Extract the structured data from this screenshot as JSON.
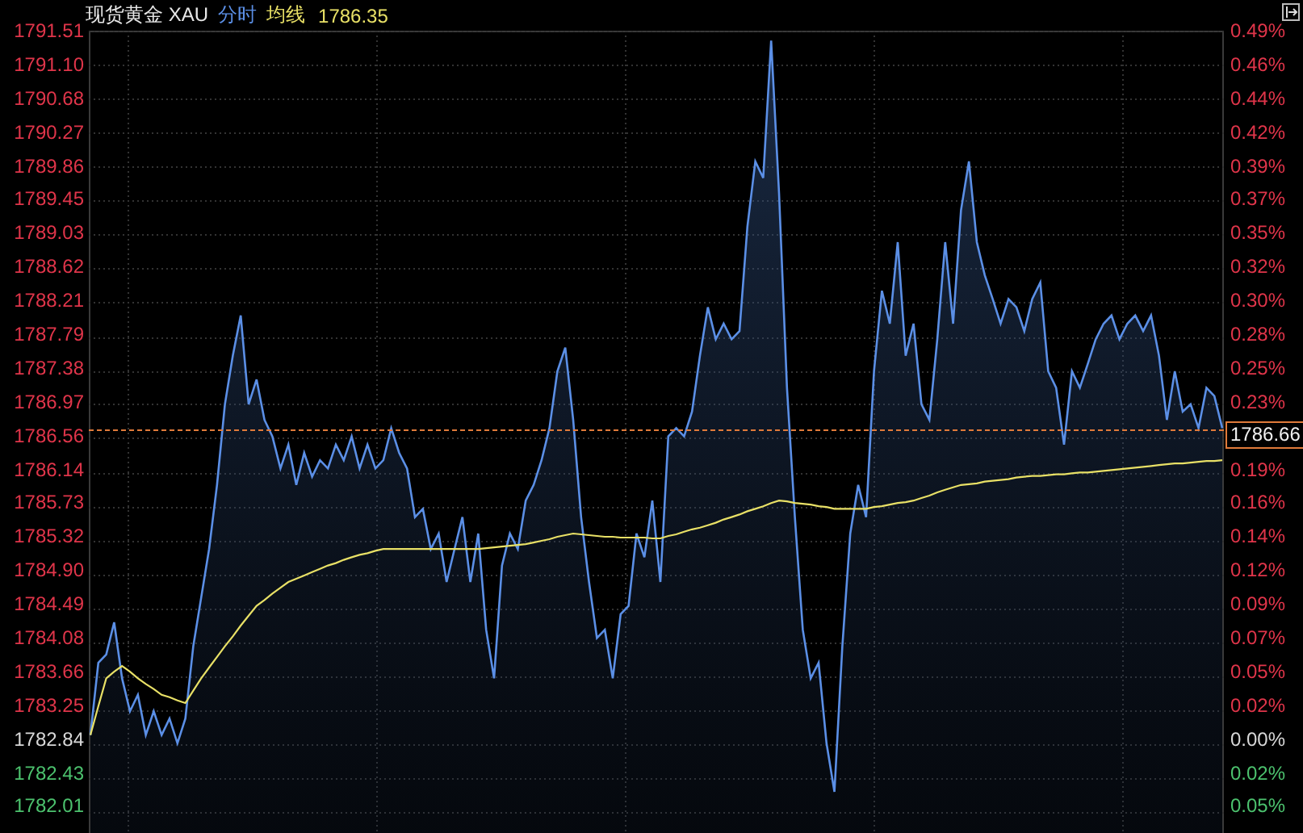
{
  "header": {
    "instrument": "现货黄金 XAU",
    "average_value": "1786.35"
  },
  "price_axis": [
    {
      "kind": "up"
    },
    {
      "kind": "up"
    },
    {
      "kind": "up"
    },
    {
      "kind": "up"
    },
    {
      "kind": "up"
    },
    {
      "kind": "up"
    },
    {
      "kind": "up"
    },
    {
      "kind": "up"
    },
    {
      "kind": "up"
    },
    {
      "kind": "up"
    },
    {
      "kind": "up"
    },
    {
      "kind": "up"
    },
    {
      "kind": "up"
    },
    {
      "kind": "up"
    },
    {
      "kind": "up"
    },
    {
      "kind": "up"
    },
    {
      "kind": "up"
    },
    {
      "kind": "up"
    },
    {
      "kind": "up"
    },
    {
      "kind": "up"
    },
    {
      "kind": "up"
    },
    {
      "kind": "flat"
    },
    {
      "kind": "down"
    },
    {
      "kind": "down"
    }
  ],
  "chart_data": {
    "type": "line",
    "ylim": [
      1781.76,
      1791.51
    ],
    "yticks": [
      {
        "value": 1791.51,
        "label": "1791.51"
      },
      {
        "value": 1791.1,
        "label": "1791.10"
      },
      {
        "value": 1790.68,
        "label": "1790.68"
      },
      {
        "value": 1790.27,
        "label": "1790.27"
      },
      {
        "value": 1789.86,
        "label": "1789.86"
      },
      {
        "value": 1789.45,
        "label": "1789.45"
      },
      {
        "value": 1789.03,
        "label": "1789.03"
      },
      {
        "value": 1788.62,
        "label": "1788.62"
      },
      {
        "value": 1788.21,
        "label": "1788.21"
      },
      {
        "value": 1787.79,
        "label": "1787.79"
      },
      {
        "value": 1787.38,
        "label": "1787.38"
      },
      {
        "value": 1786.97,
        "label": "1786.97"
      },
      {
        "value": 1786.56,
        "label": "1786.56"
      },
      {
        "value": 1786.14,
        "label": "1786.14"
      },
      {
        "value": 1785.73,
        "label": "1785.73"
      },
      {
        "value": 1785.32,
        "label": "1785.32"
      },
      {
        "value": 1784.9,
        "label": "1784.90"
      },
      {
        "value": 1784.49,
        "label": "1784.49"
      },
      {
        "value": 1784.08,
        "label": "1784.08"
      },
      {
        "value": 1783.66,
        "label": "1783.66"
      },
      {
        "value": 1783.25,
        "label": "1783.25"
      },
      {
        "value": 1782.84,
        "label": "1782.84"
      },
      {
        "value": 1782.43,
        "label": "1782.43"
      },
      {
        "value": 1782.01,
        "label": "1782.01"
      }
    ],
    "grid": true,
    "ref_lines": [
      {
        "axis": "y",
        "value": 1786.66,
        "label": "1786.66",
        "color": "#e07a3a"
      }
    ],
    "series": [
      {
        "name": "分时",
        "type": "area",
        "color": "#5b8fe6",
        "values": [
          1782.95,
          1783.83,
          1783.93,
          1784.32,
          1783.64,
          1783.24,
          1783.44,
          1782.95,
          1783.24,
          1782.95,
          1783.15,
          1782.85,
          1783.15,
          1784.03,
          1784.62,
          1785.21,
          1785.99,
          1786.97,
          1787.56,
          1788.05,
          1786.97,
          1787.27,
          1786.78,
          1786.58,
          1786.19,
          1786.48,
          1785.99,
          1786.38,
          1786.09,
          1786.29,
          1786.19,
          1786.48,
          1786.29,
          1786.58,
          1786.19,
          1786.48,
          1786.19,
          1786.29,
          1786.68,
          1786.38,
          1786.19,
          1785.6,
          1785.7,
          1785.21,
          1785.4,
          1784.81,
          1785.21,
          1785.6,
          1784.81,
          1785.4,
          1784.23,
          1783.64,
          1785.01,
          1785.4,
          1785.21,
          1785.8,
          1785.99,
          1786.29,
          1786.68,
          1787.37,
          1787.66,
          1786.78,
          1785.6,
          1784.81,
          1784.13,
          1784.23,
          1783.64,
          1784.42,
          1784.52,
          1785.4,
          1785.11,
          1785.8,
          1784.81,
          1786.58,
          1786.68,
          1786.58,
          1786.88,
          1787.56,
          1788.15,
          1787.76,
          1787.95,
          1787.76,
          1787.86,
          1789.13,
          1789.92,
          1789.72,
          1791.39,
          1789.53,
          1787.17,
          1785.6,
          1784.23,
          1783.64,
          1783.83,
          1782.85,
          1782.26,
          1784.03,
          1785.4,
          1785.99,
          1785.6,
          1787.37,
          1788.35,
          1787.95,
          1788.94,
          1787.56,
          1787.95,
          1786.97,
          1786.78,
          1787.76,
          1788.94,
          1787.95,
          1789.33,
          1789.92,
          1788.94,
          1788.54,
          1788.25,
          1787.95,
          1788.25,
          1788.15,
          1787.86,
          1788.25,
          1788.45,
          1787.37,
          1787.17,
          1786.48,
          1787.37,
          1787.17,
          1787.46,
          1787.76,
          1787.95,
          1788.05,
          1787.76,
          1787.95,
          1788.05,
          1787.86,
          1788.05,
          1787.56,
          1786.78,
          1787.37,
          1786.88,
          1786.97,
          1786.68,
          1787.17,
          1787.07,
          1786.68
        ]
      },
      {
        "name": "均线",
        "color": "#e8e066",
        "values": [
          1782.95,
          1783.3,
          1783.64,
          1783.72,
          1783.79,
          1783.72,
          1783.64,
          1783.57,
          1783.51,
          1783.44,
          1783.41,
          1783.37,
          1783.34,
          1783.49,
          1783.64,
          1783.77,
          1783.9,
          1784.03,
          1784.15,
          1784.28,
          1784.4,
          1784.52,
          1784.59,
          1784.67,
          1784.74,
          1784.81,
          1784.85,
          1784.89,
          1784.93,
          1784.97,
          1785.01,
          1785.04,
          1785.08,
          1785.11,
          1785.14,
          1785.16,
          1785.19,
          1785.21,
          1785.21,
          1785.21,
          1785.21,
          1785.21,
          1785.21,
          1785.21,
          1785.21,
          1785.21,
          1785.21,
          1785.21,
          1785.21,
          1785.21,
          1785.22,
          1785.23,
          1785.24,
          1785.25,
          1785.26,
          1785.27,
          1785.29,
          1785.31,
          1785.33,
          1785.36,
          1785.38,
          1785.4,
          1785.39,
          1785.38,
          1785.37,
          1785.36,
          1785.36,
          1785.35,
          1785.35,
          1785.35,
          1785.35,
          1785.34,
          1785.34,
          1785.37,
          1785.39,
          1785.42,
          1785.45,
          1785.47,
          1785.5,
          1785.53,
          1785.57,
          1785.6,
          1785.63,
          1785.67,
          1785.7,
          1785.73,
          1785.77,
          1785.8,
          1785.79,
          1785.77,
          1785.76,
          1785.75,
          1785.73,
          1785.72,
          1785.7,
          1785.7,
          1785.7,
          1785.7,
          1785.7,
          1785.72,
          1785.73,
          1785.75,
          1785.77,
          1785.78,
          1785.8,
          1785.83,
          1785.86,
          1785.9,
          1785.93,
          1785.96,
          1785.99,
          1786.0,
          1786.01,
          1786.03,
          1786.04,
          1786.05,
          1786.06,
          1786.08,
          1786.09,
          1786.1,
          1786.1,
          1786.11,
          1786.12,
          1786.12,
          1786.13,
          1786.14,
          1786.14,
          1786.15,
          1786.16,
          1786.17,
          1786.18,
          1786.19,
          1786.2,
          1786.21,
          1786.22,
          1786.23,
          1786.24,
          1786.25,
          1786.25,
          1786.26,
          1786.27,
          1786.28,
          1786.28,
          1786.29
        ]
      }
    ]
  },
  "percent_axis": [
    {
      "text": "0.49%",
      "kind": "up"
    },
    {
      "text": "0.46%",
      "kind": "up"
    },
    {
      "text": "0.44%",
      "kind": "up"
    },
    {
      "text": "0.42%",
      "kind": "up"
    },
    {
      "text": "0.39%",
      "kind": "up"
    },
    {
      "text": "0.37%",
      "kind": "up"
    },
    {
      "text": "0.35%",
      "kind": "up"
    },
    {
      "text": "0.32%",
      "kind": "up"
    },
    {
      "text": "0.30%",
      "kind": "up"
    },
    {
      "text": "0.28%",
      "kind": "up"
    },
    {
      "text": "0.25%",
      "kind": "up"
    },
    {
      "text": "0.23%",
      "kind": "up"
    },
    {
      "text": "0.19%",
      "kind": "up"
    },
    {
      "text": "0.16%",
      "kind": "up"
    },
    {
      "text": "0.14%",
      "kind": "up"
    },
    {
      "text": "0.12%",
      "kind": "up"
    },
    {
      "text": "0.09%",
      "kind": "up"
    },
    {
      "text": "0.07%",
      "kind": "up"
    },
    {
      "text": "0.05%",
      "kind": "up"
    },
    {
      "text": "0.02%",
      "kind": "up"
    },
    {
      "text": "0.00%",
      "kind": "flat"
    },
    {
      "text": "0.02%",
      "kind": "down"
    },
    {
      "text": "0.05%",
      "kind": "down"
    }
  ]
}
